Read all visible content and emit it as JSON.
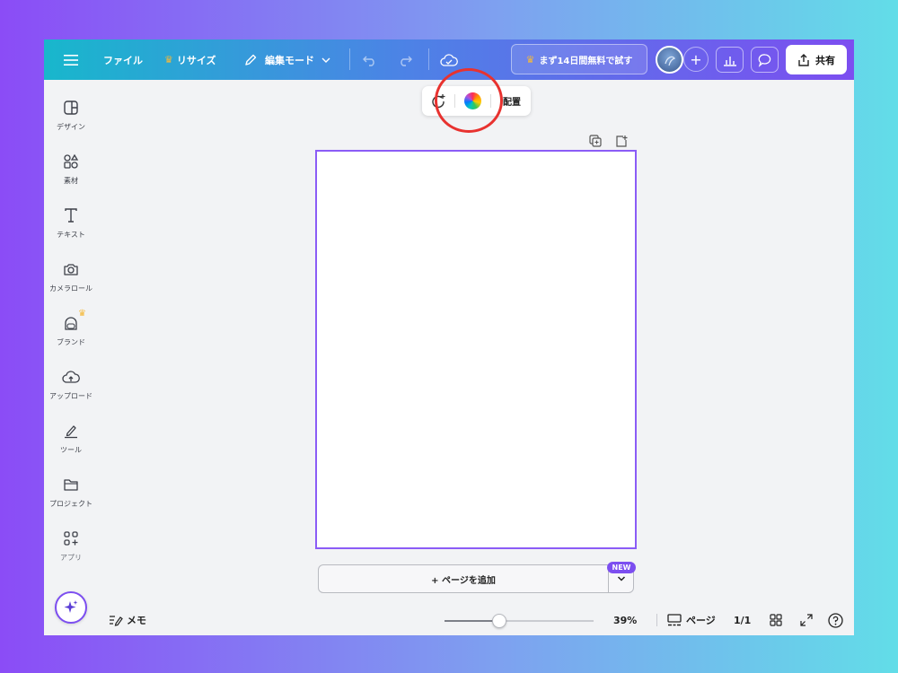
{
  "topbar": {
    "menu_icon": "hamburger-icon",
    "file_label": "ファイル",
    "resize_label": "リサイズ",
    "edit_mode_label": "編集モード",
    "trial_label": "まず14日間無料で試す",
    "plus_label": "+",
    "share_label": "共有",
    "accent_gradient": [
      "#18b7cc",
      "#4d82e6",
      "#7c4ef0"
    ],
    "crown_color": "#f5b93a"
  },
  "sidebar": {
    "items": [
      {
        "label": "デザイン",
        "icon": "design-icon"
      },
      {
        "label": "素材",
        "icon": "elements-icon"
      },
      {
        "label": "テキスト",
        "icon": "text-icon"
      },
      {
        "label": "カメラロール",
        "icon": "camera-icon"
      },
      {
        "label": "ブランド",
        "icon": "brand-icon"
      },
      {
        "label": "アップロード",
        "icon": "upload-icon"
      },
      {
        "label": "ツール",
        "icon": "tools-icon"
      },
      {
        "label": "プロジェクト",
        "icon": "folder-icon"
      },
      {
        "label": "アプリ",
        "icon": "apps-icon"
      }
    ],
    "magic_icon": "sparkle-icon"
  },
  "floating_toolbar": {
    "arrange_label": "配置",
    "highlight_color": "#e8322f"
  },
  "canvas": {
    "border_color": "#8b5cf6"
  },
  "add_page": {
    "label": "+ ページを追加",
    "badge": "NEW"
  },
  "bottombar": {
    "memo_label": "メモ",
    "zoom_value": "39%",
    "zoom_level": 0.39,
    "pages_label": "ページ",
    "page_count": "1/1"
  }
}
